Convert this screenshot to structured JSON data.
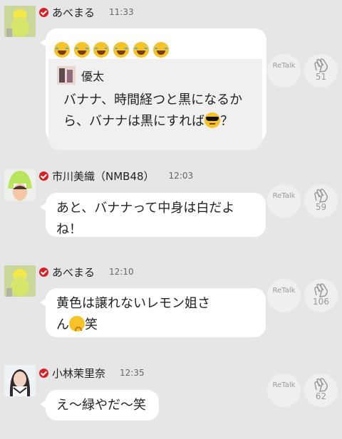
{
  "messages": [
    {
      "author": "あべまる",
      "time": "11:33",
      "emoji_row": [
        "laughing-crying",
        "laughing-crying",
        "laughing-crying",
        "laughing-crying",
        "laughing-crying",
        "laughing-crying"
      ],
      "quote": {
        "author": "優太",
        "text_line1": "バナナ、時間経つと黒になるか",
        "text_line2a": "ら、バナナは黒にすれば",
        "text_line2_emoji": "sunglasses-face",
        "text_line2b": "？"
      },
      "retalk": "ReTalk",
      "claps": "51"
    },
    {
      "author": "市川美織（NMB48）",
      "time": "12:03",
      "text_line1": "あと、バナナって中身は白だよ",
      "text_line2": "ね！",
      "retalk": "ReTalk",
      "claps": "59"
    },
    {
      "author": "あべまる",
      "time": "12:10",
      "text_line1": "黄色は譲れないレモン姐さ",
      "text_line2a": "ん",
      "text_line2_emoji": "pouting-face",
      "text_line2b": "笑",
      "retalk": "ReTalk",
      "claps": "106"
    },
    {
      "author": "小林茉里奈",
      "time": "12:35",
      "text_line1": "え〜緑やだ〜笑",
      "retalk": "ReTalk",
      "claps": "62"
    }
  ],
  "colors": {
    "background": "#e6e6e6",
    "bubble": "#ffffff",
    "quote": "#f0f0f0",
    "verified": "#d91f26",
    "button": "#efefef"
  }
}
